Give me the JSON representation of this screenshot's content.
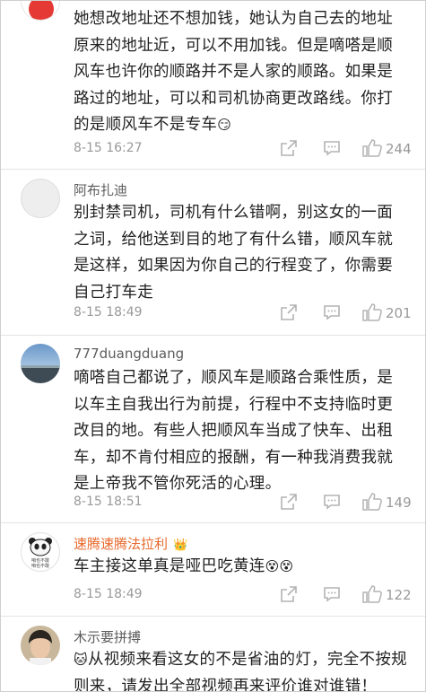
{
  "comments": [
    {
      "text": "她想改地址还不想加钱，她认为自己去的地址原来的地址近，可以不用加钱。但是嘀嗒是顺风车也许你的顺路并不是人家的顺路。如果是路过的地址，可以和司机协商更改路线。你打的是顺风车不是专车",
      "time": "8-15 16:27",
      "likes": "244",
      "emoji": "😏"
    },
    {
      "user": "阿布扎迪",
      "text": "别封禁司机，司机有什么错啊，别这女的一面之词，给他送到目的地了有什么错，顺风车就是这样，如果因为你自己的行程变了，你需要自己打车走",
      "time": "8-15 18:49",
      "likes": "201"
    },
    {
      "user": "777duangduang",
      "text": "嘀嗒自己都说了，顺风车是顺路合乘性质，是以车主自我出行为前提，行程中不支持临时更改目的地。有些人把顺风车当成了快车、出租车，却不肯付相应的报酬，有一种我消费我就是上帝我不管你死活的心理。",
      "time": "8-15 18:51",
      "likes": "149"
    },
    {
      "user": "速腾速腾法拉利",
      "badge": "👑",
      "text": "车主接这单真是哑巴吃黄连",
      "emoji": "😵😵",
      "time": "8-15 18:49",
      "likes": "122",
      "avatar_caption": "咱也不敢 咱也不敢"
    },
    {
      "user": "木示要拼搏",
      "lead_emoji": "🐱",
      "text": "从视频来看这女的不是省油的灯，完全不按规则来，请发出全部视频再来评价谁对谁错！"
    }
  ],
  "icons": [
    "share-icon",
    "reply-icon",
    "like-icon"
  ]
}
